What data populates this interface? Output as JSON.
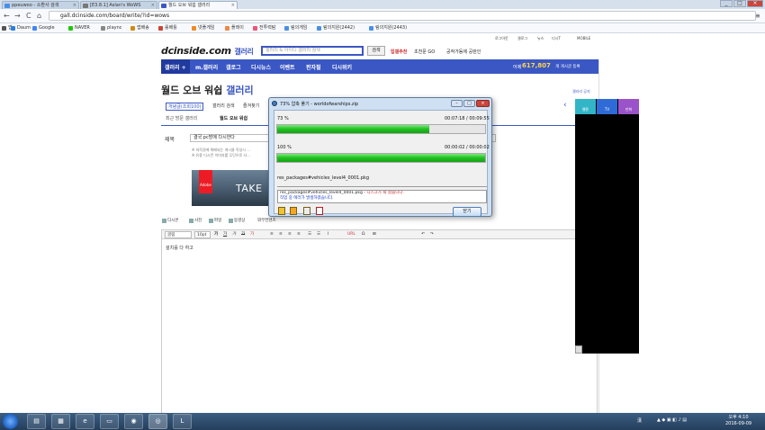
{
  "browser": {
    "tabs": [
      {
        "label": "ppeuwoo - 소환사 검색",
        "color": "#4a8fe7",
        "active": false
      },
      {
        "label": "[E3.8.1] Aslan's WoWS",
        "color": "#777",
        "active": false
      },
      {
        "label": "월드 오브 워쉽 갤러리",
        "color": "#3b57c4",
        "active": true
      }
    ],
    "url": "gall.dcinside.com/board/write/?id=wows",
    "nav": {
      "back": "←",
      "forward": "→",
      "reload": "C",
      "home": "⌂",
      "star": "☆",
      "menu": "≡"
    },
    "window_buttons": {
      "min": "_",
      "max": "□",
      "close": "×"
    },
    "bookmarks": [
      {
        "label": "앱",
        "color": "#555"
      },
      {
        "label": "Daum",
        "color": "#2d7fe0"
      },
      {
        "label": "Google",
        "color": "#4285f4"
      },
      {
        "label": "NAVER",
        "color": "#1ec800"
      },
      {
        "label": "plaync",
        "color": "#888"
      },
      {
        "label": "앱배송",
        "color": "#d08a15"
      },
      {
        "label": "롤배틀",
        "color": "#c43"
      },
      {
        "label": "넷플게임",
        "color": "#f08a24"
      },
      {
        "label": "플레이",
        "color": "#e84"
      },
      {
        "label": "전투력탐",
        "color": "#e57"
      },
      {
        "label": "림의게임",
        "color": "#4a8fe7"
      },
      {
        "label": "림의지원(2442)",
        "color": "#4a8fe7"
      },
      {
        "label": "림의지원(2443)",
        "color": "#4a8fe7"
      }
    ]
  },
  "site": {
    "logo": "dcinside.com",
    "logo_sub": "갤러리",
    "search_placeholder": "갤러리 & 아이디 갤러리 검색",
    "search_button": "검색",
    "top_links": [
      "입갤추천",
      "초천문 GO",
      "공작가동에 공란인"
    ],
    "tiny_links": [
      "로그아웃",
      "갤로그",
      "뉴스",
      "디시T",
      "MOBILE"
    ],
    "gnb": [
      "갤러리 +",
      "m.갤러리",
      "갤로그",
      "디시뉴스",
      "이벤트",
      "판자필",
      "디시위키"
    ],
    "gnb_count_label": "어제",
    "gnb_count": "617,807",
    "gnb_count_suffix": "개 게시글 등록",
    "gallery_title": "월드 오브 워쉽",
    "gallery_title_suffix": "갤러리",
    "subtabs": [
      "개념글(조회100)",
      "갤러리 검색",
      "즐겨찾기"
    ],
    "sublinks": [
      "최근 방문 갤러리",
      "월드 오브 워쉽"
    ],
    "subject_label": "제목",
    "subject_value": "결국 pc방에 다시한다",
    "notices": [
      "※ 저작권에 위배되는 게시물 작성시 ...",
      "※ 유용 디시콘 이미지를 무단으로 사..."
    ],
    "banner_brand": "Adobe",
    "banner_text": "TAKE",
    "attach": [
      "디시콘",
      "사진",
      "파일",
      "동영상",
      "외부컨텐츠"
    ],
    "toolbar": [
      "굴림",
      "10pt",
      "가",
      "가",
      "가",
      "가",
      "가",
      "≡",
      "≡",
      "≡",
      "≡",
      "☰",
      "☰",
      "I",
      "URL",
      "Ω",
      "⊞",
      "↶",
      "↷"
    ],
    "editor_text": "설치를 다 하고",
    "gallery_label": "갤러리 공지",
    "side_buttons": [
      {
        "label": "웹툰",
        "color": "#32b5c7"
      },
      {
        "label": "TV",
        "color": "#2e6bd6"
      },
      {
        "label": "만화",
        "color": "#9b53c9"
      }
    ]
  },
  "dialog": {
    "title": "73% 압축 풀기 - worldofwarships.zip",
    "buttons": {
      "min": "–",
      "max": "□",
      "close": "×"
    },
    "progress1_label": "73 %",
    "progress1_time": "00:07:18 / 00:09:55",
    "progress1_fraction": 0.73,
    "progress2_label": "100 %",
    "progress2_time": "00:00:02 / 00:00:02",
    "progress2_fraction": 1.0,
    "current_file": "res_packages#vehicles_level4_0001.pkg",
    "log_file": "res_packages#vehicles_level4_0001.pkg - ",
    "log_error": "디스크가 꽉 찼습니다.",
    "log_line2": "작업 중 에러가 발생하였습니다.",
    "close_button": "닫기"
  },
  "taskbar": {
    "clock_time": "오후 4:10",
    "clock_date": "2016-09-09",
    "ime": "漢"
  }
}
